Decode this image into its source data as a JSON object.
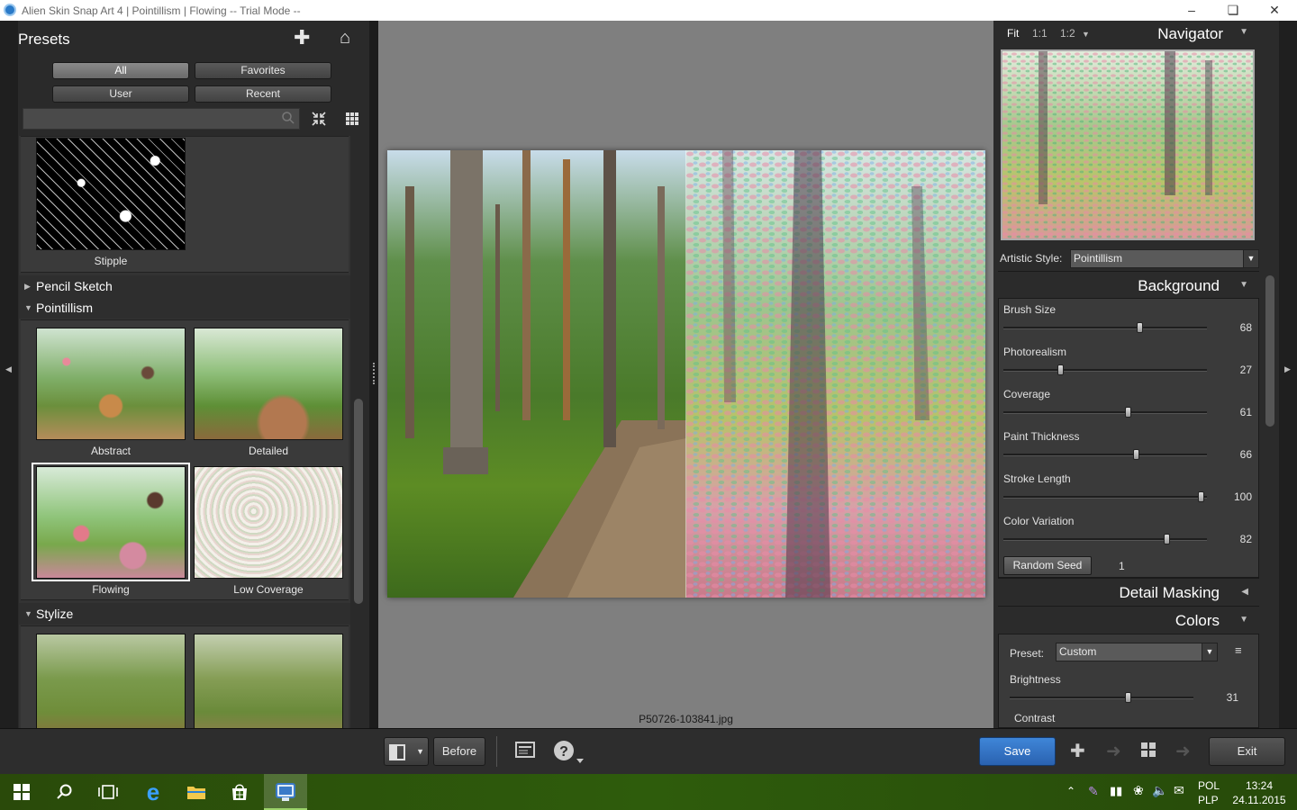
{
  "window": {
    "title": "Alien Skin Snap Art 4 | Pointillism | Flowing -- Trial Mode --"
  },
  "presets": {
    "title": "Presets",
    "filters": [
      "All",
      "Favorites",
      "User",
      "Recent"
    ],
    "active_filter": "All",
    "search_placeholder": "",
    "stipple_label": "Stipple",
    "categories": {
      "pencil_sketch": "Pencil Sketch",
      "pointillism": "Pointillism",
      "stylize": "Stylize"
    },
    "pointillism_items": [
      "Abstract",
      "Detailed",
      "Flowing",
      "Low Coverage"
    ],
    "selected_item": "Flowing"
  },
  "canvas": {
    "filename": "P50726-103841.jpg"
  },
  "navigator": {
    "title": "Navigator",
    "zoom_options": [
      "Fit",
      "1:1",
      "1:2"
    ],
    "active_zoom": "Fit"
  },
  "artistic_style": {
    "label": "Artistic Style:",
    "value": "Pointillism"
  },
  "background": {
    "title": "Background",
    "sliders": [
      {
        "label": "Brush Size",
        "value": 68,
        "fraction": 0.67
      },
      {
        "label": "Photorealism",
        "value": 27,
        "fraction": 0.28
      },
      {
        "label": "Coverage",
        "value": 61,
        "fraction": 0.61
      },
      {
        "label": "Paint Thickness",
        "value": 66,
        "fraction": 0.65
      },
      {
        "label": "Stroke Length",
        "value": 100,
        "fraction": 0.97
      },
      {
        "label": "Color Variation",
        "value": 82,
        "fraction": 0.8
      }
    ],
    "random_seed_label": "Random Seed",
    "random_seed_value": "1"
  },
  "detail_masking": {
    "title": "Detail Masking"
  },
  "colors": {
    "title": "Colors",
    "preset_label": "Preset:",
    "preset_value": "Custom",
    "brightness_label": "Brightness",
    "brightness_value": 31,
    "brightness_fraction": 0.64,
    "contrast_label": "Contrast"
  },
  "toolbar": {
    "before_label": "Before",
    "save_label": "Save",
    "exit_label": "Exit"
  },
  "taskbar": {
    "lang_top": "POL",
    "lang_bottom": "PLP",
    "time": "13:24",
    "date": "24.11.2015"
  },
  "colors_theme": {
    "save_button": "#2e6fbf",
    "taskbar": "#2e5c0c",
    "panel": "#2b2b2b"
  }
}
